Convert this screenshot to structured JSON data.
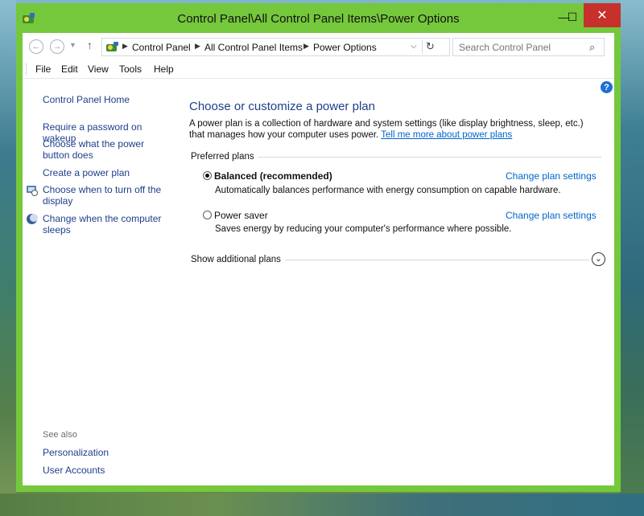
{
  "window": {
    "title": "Control Panel\\All Control Panel Items\\Power Options",
    "accent": "#75c83c",
    "close_color": "#c7302b",
    "minimize_glyph": "—",
    "maximize_glyph": "☐",
    "close_glyph": "✕"
  },
  "address": {
    "crumbs": [
      "Control Panel",
      "All Control Panel Items",
      "Power Options"
    ]
  },
  "search": {
    "placeholder": "Search Control Panel"
  },
  "menu": {
    "items": [
      "File",
      "Edit",
      "View",
      "Tools",
      "Help"
    ]
  },
  "sidebar": {
    "home": "Control Panel Home",
    "links": [
      "Require a password on wakeup",
      "Choose what the power button does",
      "Create a power plan",
      "Choose when to turn off the display",
      "Change when the computer sleeps"
    ],
    "see_also_title": "See also",
    "see_also": [
      "Personalization",
      "User Accounts"
    ]
  },
  "main": {
    "title": "Choose or customize a power plan",
    "description": "A power plan is a collection of hardware and system settings (like display brightness, sleep, etc.) that manages how your computer uses power.",
    "learn_more": "Tell me more about power plans",
    "preferred_label": "Preferred plans",
    "plans": [
      {
        "name": "Balanced (recommended)",
        "selected": true,
        "description": "Automatically balances performance with energy consumption on capable hardware.",
        "link": "Change plan settings"
      },
      {
        "name": "Power saver",
        "selected": false,
        "description": "Saves energy by reducing your computer's performance where possible.",
        "link": "Change plan settings"
      }
    ],
    "show_more": "Show additional plans"
  }
}
